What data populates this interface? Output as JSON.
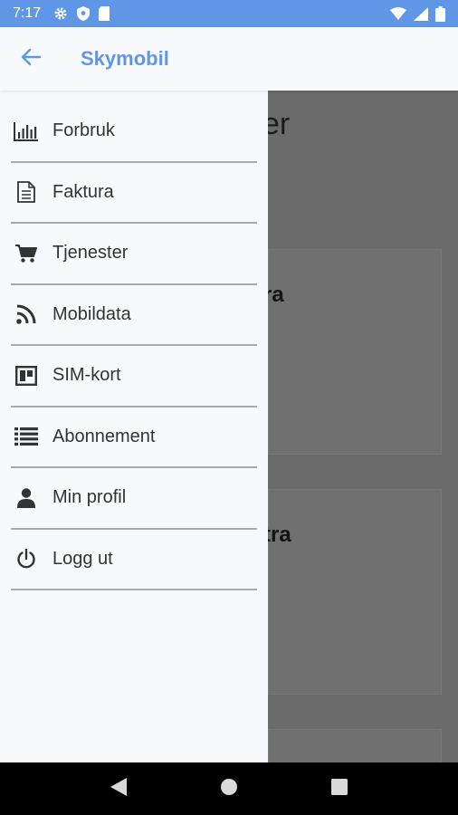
{
  "status_bar": {
    "time": "7:17",
    "icons_left": [
      "gear-icon",
      "shield-icon",
      "sd-card-icon"
    ],
    "icons_right": [
      "wifi-icon",
      "signal-icon",
      "battery-icon"
    ],
    "bg_color": "#5f97e6"
  },
  "app_bar": {
    "title": "Skymobil",
    "back_icon": "arrow-left-icon",
    "accent_color": "#5f97e6"
  },
  "drawer": {
    "items": [
      {
        "label": "Forbruk",
        "icon": "bar-chart-icon"
      },
      {
        "label": "Faktura",
        "icon": "document-icon"
      },
      {
        "label": "Tjenester",
        "icon": "cart-icon"
      },
      {
        "label": "Mobildata",
        "icon": "rss-icon"
      },
      {
        "label": "SIM-kort",
        "icon": "sim-card-icon"
      },
      {
        "label": "Abonnement",
        "icon": "list-icon"
      },
      {
        "label": "Min profil",
        "icon": "user-icon"
      },
      {
        "label": "Logg ut",
        "icon": "power-icon"
      }
    ]
  },
  "background_page": {
    "title_fragment": "er",
    "card_1_title_fragment": "ra",
    "card_2_title_fragment": "tra"
  },
  "nav_bar": {
    "icons": [
      "back-triangle-icon",
      "home-circle-icon",
      "recents-square-icon"
    ]
  }
}
